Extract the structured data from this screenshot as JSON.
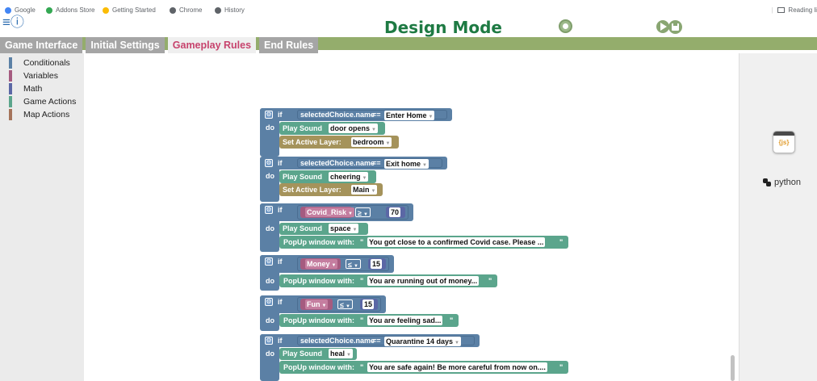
{
  "bookmarks": {
    "items": [
      "Google",
      "Addons Store",
      "Getting Started",
      "Chrome",
      "History"
    ],
    "reading_list": "Reading li"
  },
  "header": {
    "title": "Design Mode"
  },
  "tabs": [
    "Game Interface",
    "Initial Settings",
    "Gameplay Rules",
    "End Rules"
  ],
  "active_tab": "Gameplay Rules",
  "sidebar": {
    "categories": [
      {
        "label": "Conditionals",
        "color": "#5b80a5"
      },
      {
        "label": "Variables",
        "color": "#a55b80"
      },
      {
        "label": "Math",
        "color": "#5b67a5"
      },
      {
        "label": "Game Actions",
        "color": "#5ba58c"
      },
      {
        "label": "Map Actions",
        "color": "#a5745b"
      }
    ]
  },
  "right_panel": {
    "js_label": "{js}",
    "python_label": "python"
  },
  "blocks": {
    "kw_if": "if",
    "kw_do": "do",
    "b1": {
      "var": "selectedChoice.name",
      "op": "==",
      "value": "Enter Home",
      "sound_label": "Play Sound",
      "sound": "door opens",
      "layer_label": "Set Active Layer:",
      "layer": "bedroom"
    },
    "b2": {
      "var": "selectedChoice.name",
      "op": "==",
      "value": "Exit home",
      "sound_label": "Play Sound",
      "sound": "cheering",
      "layer_label": "Set Active Layer:",
      "layer": "Main"
    },
    "b3": {
      "var": "Covid_Risk",
      "op": "≥",
      "num": "70",
      "sound_label": "Play Sound",
      "sound": "space",
      "popup_label": "PopUp window with:",
      "q1": "\"",
      "popup": "You got close to a confirmed Covid case. Please ...",
      "q2": "\""
    },
    "b4": {
      "var": "Money",
      "op": "≤",
      "num": "15",
      "popup_label": "PopUp window with:",
      "q1": "\"",
      "popup": "You are running out of money...",
      "q2": "\""
    },
    "b5": {
      "var": "Fun",
      "op": "≤",
      "num": "15",
      "popup_label": "PopUp window with:",
      "q1": "\"",
      "popup": "You are feeling sad...",
      "q2": "\""
    },
    "b6": {
      "var": "selectedChoice.name",
      "op": "==",
      "value": "Quarantine 14 days",
      "sound_label": "Play Sound",
      "sound": "heal",
      "popup_label": "PopUp window with:",
      "q1": "\"",
      "popup": "You are safe again! Be more careful from now on....",
      "q2": "\""
    }
  }
}
